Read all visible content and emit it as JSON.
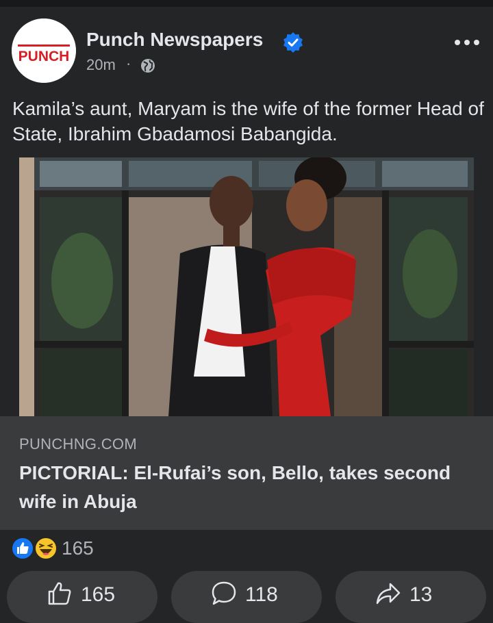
{
  "post": {
    "page_name": "Punch Newspapers",
    "avatar_logo_text": "PUNCH",
    "time": "20m",
    "separator": "·",
    "audience_icon": "globe-icon",
    "more_icon": "more-horizontal-icon",
    "text": "Kamila’s aunt, Maryam is the wife of the former Head of State, Ibrahim Gbadamosi Babangida."
  },
  "link_preview": {
    "domain": "PUNCHNG.COM",
    "headline": "PICTORIAL: El-Rufai’s son, Bello, takes second wife in Abuja"
  },
  "reactions": {
    "icons": [
      "like-reaction-icon",
      "haha-reaction-icon"
    ],
    "count": "165"
  },
  "actions": {
    "like_count": "165",
    "comment_count": "118",
    "share_count": "13"
  },
  "colors": {
    "background": "#242526",
    "card": "#3a3b3c",
    "text_primary": "#e4e6eb",
    "text_secondary": "#b0b3b8",
    "verified_blue": "#1877f2",
    "punch_red": "#d81e25"
  }
}
